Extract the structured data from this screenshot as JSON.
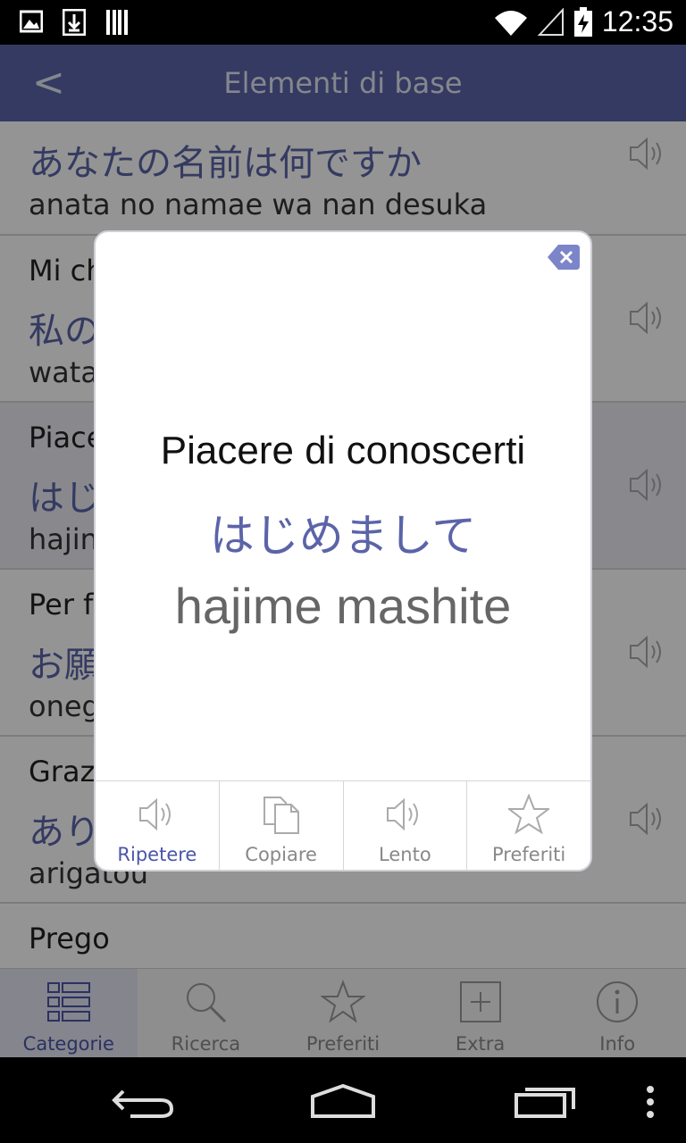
{
  "status_bar": {
    "time": "12:35",
    "left_icons": [
      "image-icon",
      "download-icon",
      "barcode-icon"
    ],
    "right_icons": [
      "wifi-icon",
      "signal-icon",
      "battery-charging-icon"
    ]
  },
  "app_bar": {
    "back_label": "<",
    "title": "Elementi di base"
  },
  "list": {
    "items": [
      {
        "italian": "",
        "japanese": "あなたの名前は何ですか",
        "romaji": "anata no namae wa nan desuka"
      },
      {
        "italian": "Mi ch",
        "japanese": "私の",
        "romaji": "wata"
      },
      {
        "italian": "Piace",
        "japanese": "はじ",
        "romaji": "hajin"
      },
      {
        "italian": "Per f",
        "japanese": "お願",
        "romaji": "oneg"
      },
      {
        "italian": "Graz",
        "japanese": "あり",
        "romaji": "arigatou"
      },
      {
        "italian": "Prego",
        "japanese": "",
        "romaji": ""
      }
    ]
  },
  "dialog": {
    "italian": "Piacere di conoscerti",
    "japanese": "はじめまして",
    "romaji": "hajime mashite",
    "actions": [
      {
        "label": "Ripetere",
        "icon": "speaker-icon",
        "active": true
      },
      {
        "label": "Copiare",
        "icon": "copy-icon",
        "active": false
      },
      {
        "label": "Lento",
        "icon": "speaker-slow-icon",
        "active": false
      },
      {
        "label": "Preferiti",
        "icon": "star-icon",
        "active": false
      }
    ]
  },
  "tabs": [
    {
      "label": "Categorie",
      "icon": "categories-icon",
      "active": true
    },
    {
      "label": "Ricerca",
      "icon": "search-icon",
      "active": false
    },
    {
      "label": "Preferiti",
      "icon": "star-icon",
      "active": false
    },
    {
      "label": "Extra",
      "icon": "plus-box-icon",
      "active": false
    },
    {
      "label": "Info",
      "icon": "info-icon",
      "active": false
    }
  ],
  "colors": {
    "accent": "#5b64a8",
    "app_bar": "#5b64a8"
  }
}
